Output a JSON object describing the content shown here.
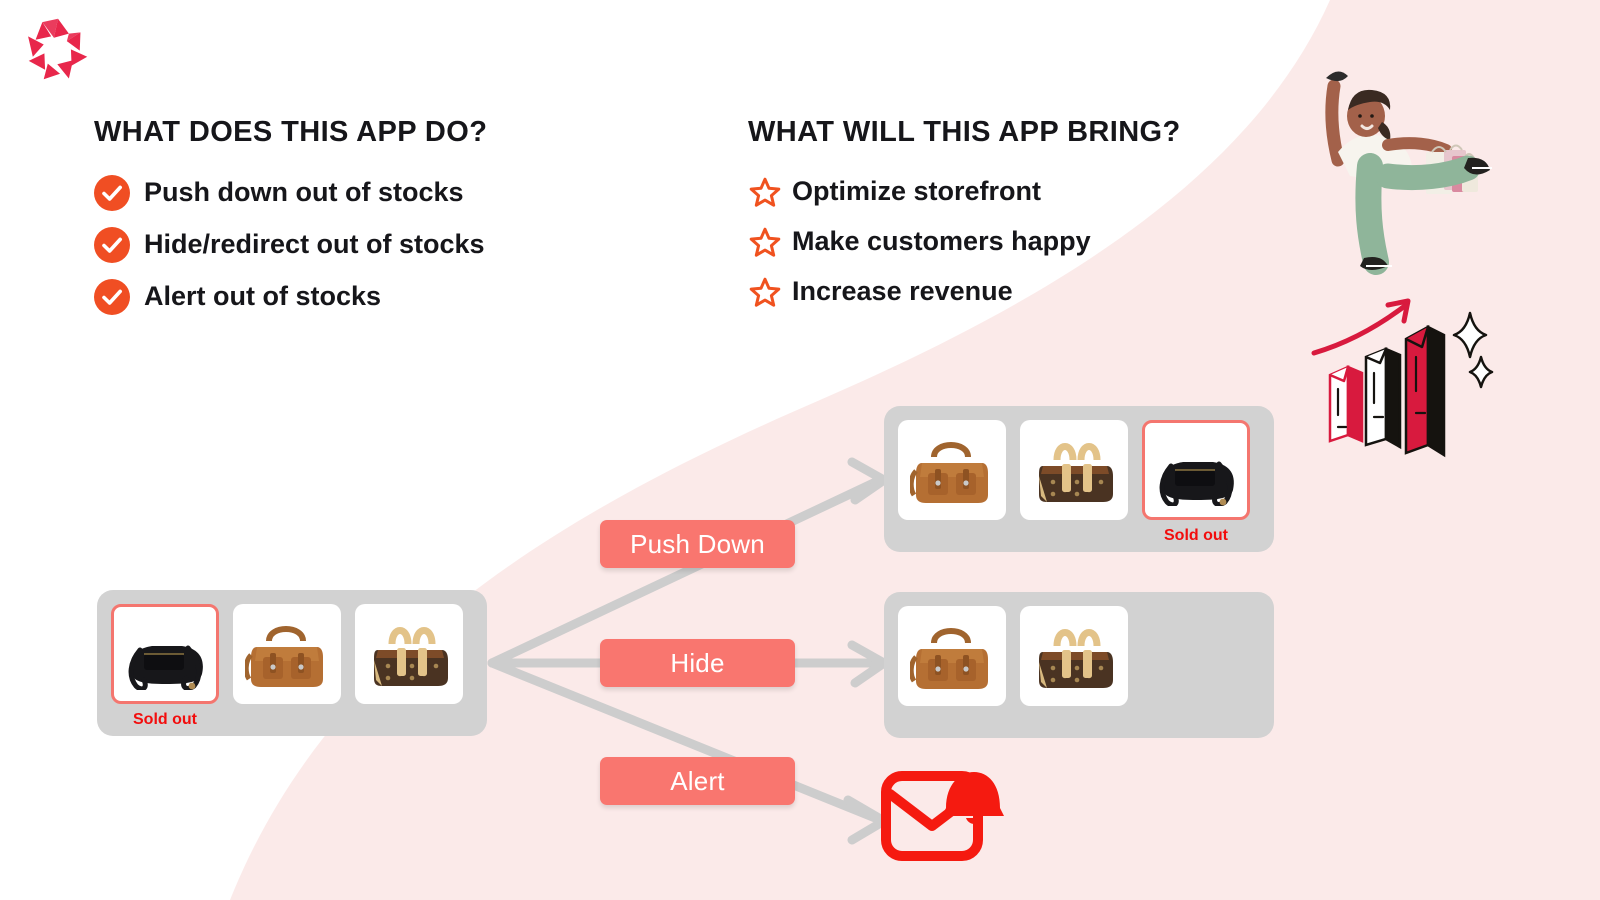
{
  "brand": {
    "logo_name": "pinwheel-star-logo",
    "logo_color": "#e8274b"
  },
  "colors": {
    "background": "#ffffff",
    "accent_pink_panel": "#fbeae9",
    "badge": "#f9766f",
    "check_orange": "#f04e23",
    "star_orange": "#f0521f",
    "sold_out_red": "#f20d0d",
    "grid_gray": "#d2d2d2",
    "connector_gray": "#cccccc",
    "alert_red": "#f51a10",
    "heading_black": "#16161a"
  },
  "columns": {
    "left": {
      "title": "WHAT DOES THIS APP DO?",
      "bullet_icon": "check-circle-icon",
      "items": [
        {
          "label": "Push down out of stocks"
        },
        {
          "label": "Hide/redirect out of stocks"
        },
        {
          "label": "Alert out of stocks"
        }
      ]
    },
    "right": {
      "title": "WHAT WILL THIS APP BRING?",
      "bullet_icon": "star-outline-icon",
      "items": [
        {
          "label": "Optimize storefront"
        },
        {
          "label": "Make customers happy"
        },
        {
          "label": "Increase revenue"
        }
      ]
    }
  },
  "illustrations": [
    {
      "name": "shopper-woman-illustration",
      "description": "woman holding shopping bags"
    },
    {
      "name": "growth-bar-chart-illustration",
      "description": "rising bar chart with arrow and sparkles"
    }
  ],
  "flow": {
    "source_grid": {
      "name": "source-product-grid",
      "tiles": [
        {
          "name": "product-tile-black-crossbody",
          "bag": "black-crossbody",
          "sold_out": true,
          "sold_out_label": "Sold out"
        },
        {
          "name": "product-tile-tan-satchel",
          "bag": "tan-satchel",
          "sold_out": false
        },
        {
          "name": "product-tile-monogram-bowler",
          "bag": "monogram-bowler",
          "sold_out": false
        }
      ]
    },
    "actions": [
      {
        "name": "push-down-badge",
        "label": "Push Down"
      },
      {
        "name": "hide-badge",
        "label": "Hide"
      },
      {
        "name": "alert-badge",
        "label": "Alert"
      }
    ],
    "results": {
      "push_down_grid": {
        "name": "push-down-result-grid",
        "tiles": [
          {
            "name": "product-tile-tan-satchel",
            "bag": "tan-satchel",
            "sold_out": false
          },
          {
            "name": "product-tile-monogram-bowler",
            "bag": "monogram-bowler",
            "sold_out": false
          },
          {
            "name": "product-tile-black-crossbody",
            "bag": "black-crossbody",
            "sold_out": true,
            "sold_out_label": "Sold out"
          }
        ]
      },
      "hide_grid": {
        "name": "hide-result-grid",
        "tiles": [
          {
            "name": "product-tile-tan-satchel",
            "bag": "tan-satchel",
            "sold_out": false
          },
          {
            "name": "product-tile-monogram-bowler",
            "bag": "monogram-bowler",
            "sold_out": false
          }
        ]
      },
      "alert_output": {
        "name": "email-bell-alert-icon",
        "description": "envelope with notification bell"
      }
    }
  }
}
